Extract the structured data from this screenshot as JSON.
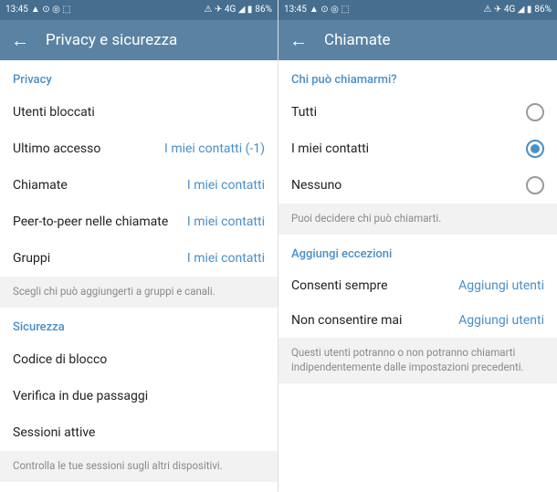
{
  "status": {
    "time": "13:45",
    "battery": "86%",
    "icons_left": "▲ ⊙ ◎ ⬚",
    "icons_right": "⚠ ✈ 4G ◢ ▮"
  },
  "left": {
    "title": "Privacy e sicurezza",
    "section_privacy": "Privacy",
    "rows": {
      "blocked": {
        "label": "Utenti bloccati",
        "value": ""
      },
      "lastseen": {
        "label": "Ultimo accesso",
        "value": "I miei contatti (-1)"
      },
      "calls": {
        "label": "Chiamate",
        "value": "I miei contatti"
      },
      "p2p": {
        "label": "Peer-to-peer nelle chiamate",
        "value": "I miei contatti"
      },
      "groups": {
        "label": "Gruppi",
        "value": "I miei contatti"
      }
    },
    "info_groups": "Scegli chi può aggiungerti a gruppi e canali.",
    "section_security": "Sicurezza",
    "security_rows": {
      "passcode": "Codice di blocco",
      "twostep": "Verifica in due passaggi",
      "sessions": "Sessioni attive"
    },
    "info_sessions": "Controlla le tue sessioni sugli altri dispositivi."
  },
  "right": {
    "title": "Chiamate",
    "section_who": "Chi può chiamarmi?",
    "options": {
      "everyone": "Tutti",
      "contacts": "I miei contatti",
      "nobody": "Nessuno"
    },
    "info_who": "Puoi decidere chi può chiamarti.",
    "section_exceptions": "Aggiungi eccezioni",
    "exceptions": {
      "always": {
        "label": "Consenti sempre",
        "value": "Aggiungi utenti"
      },
      "never": {
        "label": "Non consentire mai",
        "value": "Aggiungi utenti"
      }
    },
    "info_exceptions": "Questi utenti potranno o non potranno chiamarti indipendentemente dalle impostazioni precedenti."
  }
}
